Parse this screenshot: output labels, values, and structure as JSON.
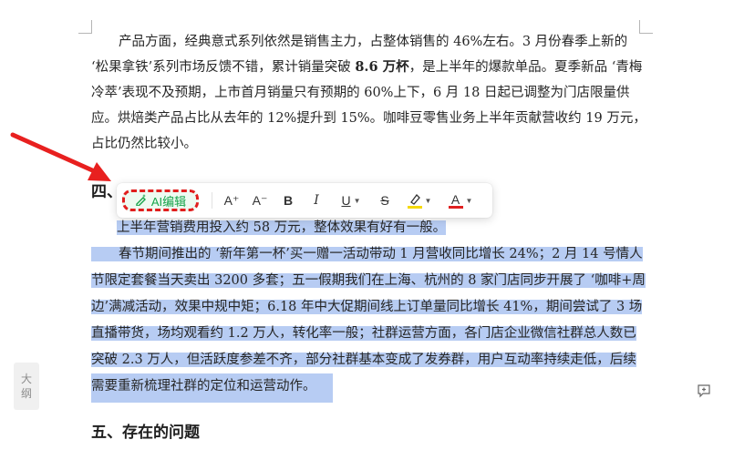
{
  "paragraph1": {
    "lines": [
      [
        "产品方面，经典意式系列依然是销售主力，占整体销售的 46%左右。3 月份春季上新的"
      ],
      [
        "‘松果拿铁’系列市场反馈不错，累计销量突破 ",
        "8.6 万杯",
        "，是上半年的爆款单品。夏季新品 ‘青梅"
      ],
      [
        "冷萃’表现不及预期，上市首月销量只有预期的 60%上下，6 月 18 日起已调整为门店限量供"
      ],
      [
        "应。烘焙类产品占比从去年的 12%提升到 15%。咖啡豆零售业务上半年贡献营收约 19 万元，"
      ],
      [
        "占比仍然比较小。"
      ]
    ]
  },
  "heading4": "四、",
  "marketing": {
    "line1": "上半年营销费用投入约 58 万元，整体效果有好有一般。",
    "lines": [
      "春节期间推出的 ‘新年第一杯’买一赠一活动带动 1 月营收同比增长 24%；2 月 14 号情人",
      "节限定套餐当天卖出 3200 多套；五一假期我们在上海、杭州的 8 家门店同步开展了 ‘咖啡+周",
      "边’满减活动，效果中规中矩；6.18 年中大促期间线上订单量同比增长 41%，期间尝试了 3 场",
      "直播带货，场均观看约 1.2 万人，转化率一般；社群运营方面，各门店企业微信社群总人数已",
      "突破 2.3 万人，但活跃度参差不齐，部分社群基本变成了发券群，用户互动率持续走低，后续",
      "需要重新梳理社群的定位和运营动作。"
    ]
  },
  "heading5": "五、存在的问题",
  "toolbar": {
    "ai_label": "AI编辑",
    "font_larger": "A⁺",
    "font_smaller": "A⁻",
    "bold": "B",
    "italic": "I",
    "underline": "U",
    "strike": "S",
    "highlight_color": "#f5d90a",
    "font_color": "#e02020"
  },
  "side_tab": [
    "大",
    "纲"
  ],
  "icons": {
    "ai": "sparkle-pen-icon",
    "comment": "comment-add-icon"
  }
}
